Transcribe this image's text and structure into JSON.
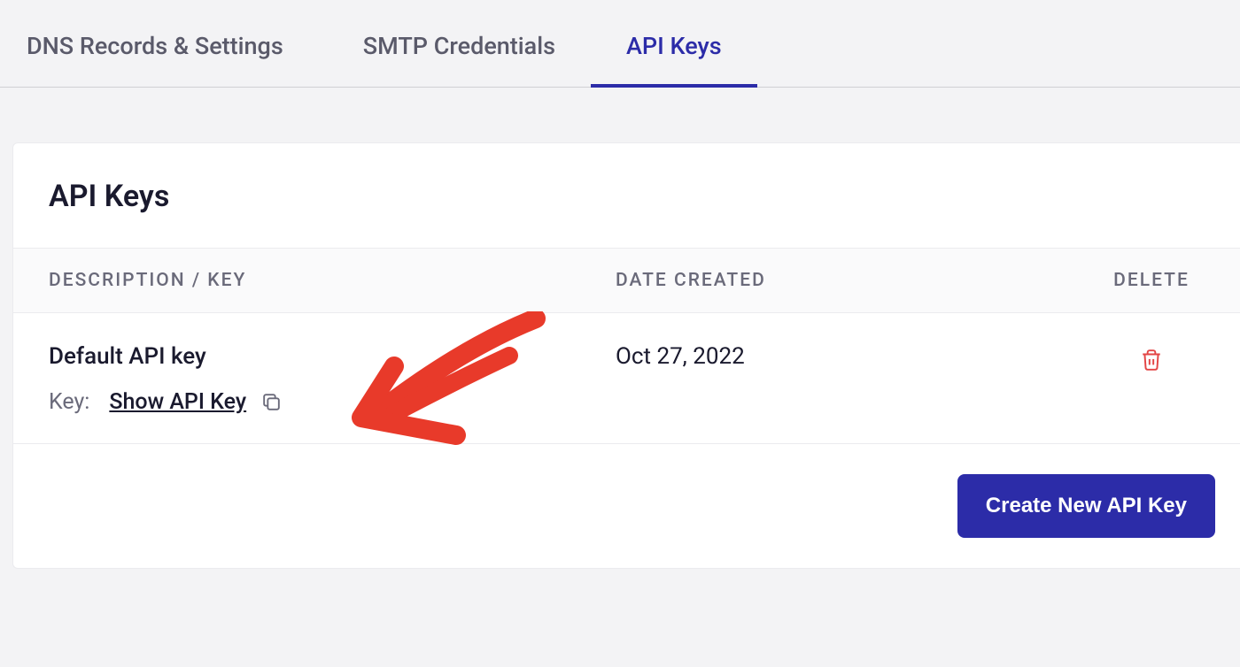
{
  "tabs": [
    {
      "label": "DNS Records & Settings",
      "active": false
    },
    {
      "label": "SMTP Credentials",
      "active": false
    },
    {
      "label": "API Keys",
      "active": true
    }
  ],
  "card": {
    "title": "API Keys",
    "columns": {
      "description": "DESCRIPTION / KEY",
      "date": "DATE CREATED",
      "delete": "DELETE"
    },
    "rows": [
      {
        "name": "Default API key",
        "keyLabel": "Key:",
        "showKeyLabel": "Show API Key",
        "dateCreated": "Oct 27, 2022"
      }
    ],
    "createButton": "Create New API Key"
  }
}
